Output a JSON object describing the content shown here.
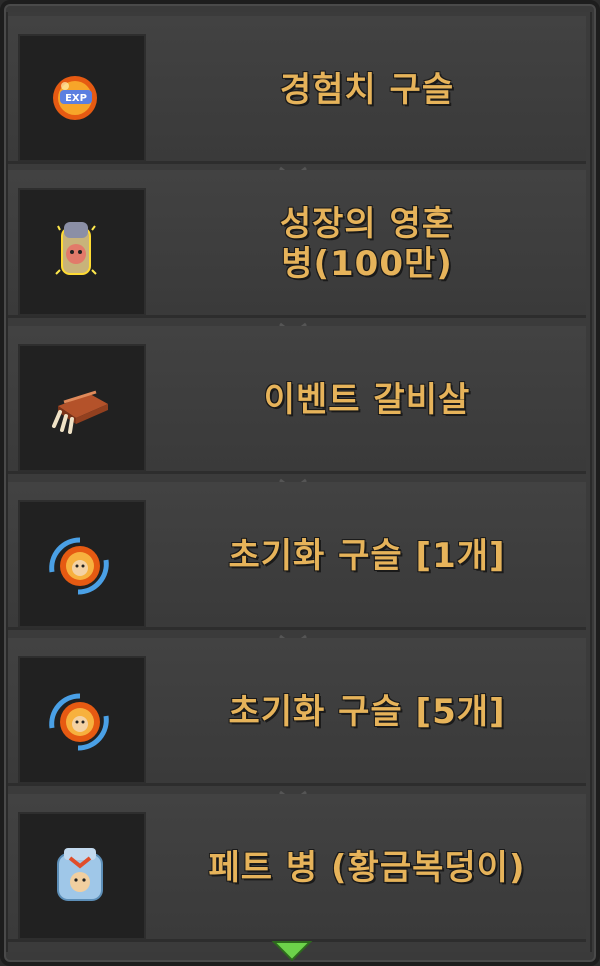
{
  "items": [
    {
      "label": "경험치 구슬",
      "icon": "exp-orb-icon"
    },
    {
      "label": "성장의 영혼\n병(100만)",
      "icon": "growth-soul-bottle-icon"
    },
    {
      "label": "이벤트 갈비살",
      "icon": "rib-meat-icon"
    },
    {
      "label": "초기화 구슬 [1개]",
      "icon": "reset-orb-icon"
    },
    {
      "label": "초기화 구슬 [5개]",
      "icon": "reset-orb-icon"
    },
    {
      "label": "페트 병 (황금복덩이)",
      "icon": "pet-bottle-golden-icon"
    }
  ],
  "colors": {
    "label": "#e6b35a",
    "panel": "#3b3b3b",
    "slot": "#212121",
    "accent_arrow": "#6cd24a"
  },
  "scroll_indicator_icon": "chevron-down-icon"
}
